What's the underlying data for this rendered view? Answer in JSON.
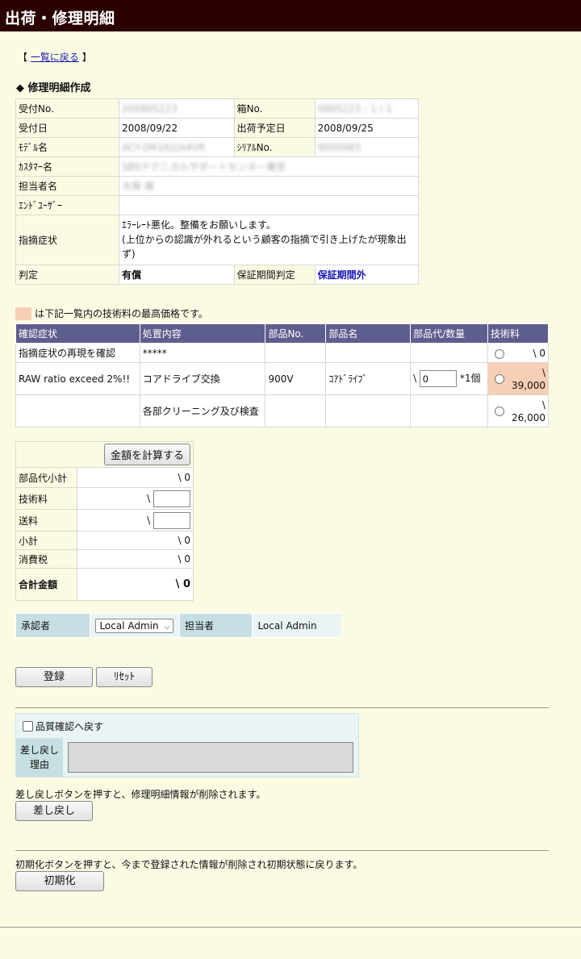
{
  "header": {
    "title": "出荷・修理明細"
  },
  "nav": {
    "back_open": "【",
    "back_label": "一覧に戻る",
    "back_close": "】"
  },
  "section": {
    "title": "◆ 修理明細作成"
  },
  "info": {
    "receipt_no_label": "受付No.",
    "receipt_no": "200805223",
    "box_no_label": "箱No.",
    "box_no": "0805223 - 1 / 1",
    "receipt_date_label": "受付日",
    "receipt_date": "2008/09/22",
    "ship_date_label": "出荷予定日",
    "ship_date": "2008/09/25",
    "model_label": "ﾓﾃﾞﾙ名",
    "model": "ACY-DR162/A4VR",
    "serial_label": "ｼﾘｱﾙNo.",
    "serial": "9000983",
    "customer_label": "ｶｽﾀﾏｰ名",
    "customer": "SBSテクニカルサポートセンター東京",
    "staff_label": "担当者名",
    "staff": "大塚 様",
    "enduser_label": "ｴﾝﾄﾞﾕｰｻﾞｰ",
    "enduser": "",
    "symptom_label": "指摘症状",
    "symptom_line1": "ｴﾗｰﾚｰﾄ悪化。整備をお願いします。",
    "symptom_line2": "(上位からの認識が外れるという顧客の指摘で引き上げたが現象出ず)",
    "judgement_label": "判定",
    "judgement": "有償",
    "warranty_label": "保証期間判定",
    "warranty": "保証期間外"
  },
  "legend": {
    "text": "は下記一覧内の技術料の最高価格です。"
  },
  "work_table": {
    "headers": [
      "確認症状",
      "処置内容",
      "部品No.",
      "部品名",
      "部品代/数量",
      "技術料"
    ],
    "rows": [
      {
        "symptom": "指摘症状の再現を確認",
        "action": "*****",
        "part_no": "",
        "part_name": "",
        "qty": "",
        "fee": "\\ 0"
      },
      {
        "symptom": "RAW ratio exceed 2%!!",
        "action": "コアドライブ交換",
        "part_no": "900V",
        "part_name": "ｺｱﾄﾞﾗｲﾌﾞ",
        "qty_prefix": "\\",
        "qty_value": "0",
        "qty_suffix": "*1個",
        "fee_yen": "\\",
        "fee_amount": "39,000"
      },
      {
        "symptom": "",
        "action": "各部クリーニング及び検査",
        "part_no": "",
        "part_name": "",
        "qty": "",
        "fee_yen": "\\",
        "fee_amount": "26,000"
      }
    ]
  },
  "calc": {
    "button": "金額を計算する",
    "parts_label": "部品代小計",
    "parts_value": "\\ 0",
    "tech_label": "技術料",
    "tech_prefix": "\\",
    "ship_label": "送料",
    "ship_prefix": "\\",
    "subtotal_label": "小計",
    "subtotal_value": "\\ 0",
    "tax_label": "消費税",
    "tax_value": "\\ 0",
    "total_label": "合計金額",
    "total_value": "\\ 0"
  },
  "approval": {
    "approver_label": "承認者",
    "approver_value": "Local Admin",
    "staff_label": "担当者",
    "staff_value": "Local Admin"
  },
  "buttons": {
    "register": "登録",
    "reset": "ﾘｾｯﾄ",
    "send_back": "差し戻し",
    "init": "初期化"
  },
  "revert": {
    "checkbox_label": "品質確認へ戻す",
    "reason_label_1": "差し戻し",
    "reason_label_2": "理由",
    "note": "差し戻しボタンを押すと、修理明細情報が削除されます。"
  },
  "init_note": "初期化ボタンを押すと、今まで登録された情報が削除され初期状態に戻ります。",
  "colors": {
    "header_bg": "#2a0000",
    "page_bg": "#fbfbe3",
    "table_header_bg": "#5e5e8e",
    "highlight": "#f7cfb4",
    "approval_bg": "#c7dfe2"
  }
}
